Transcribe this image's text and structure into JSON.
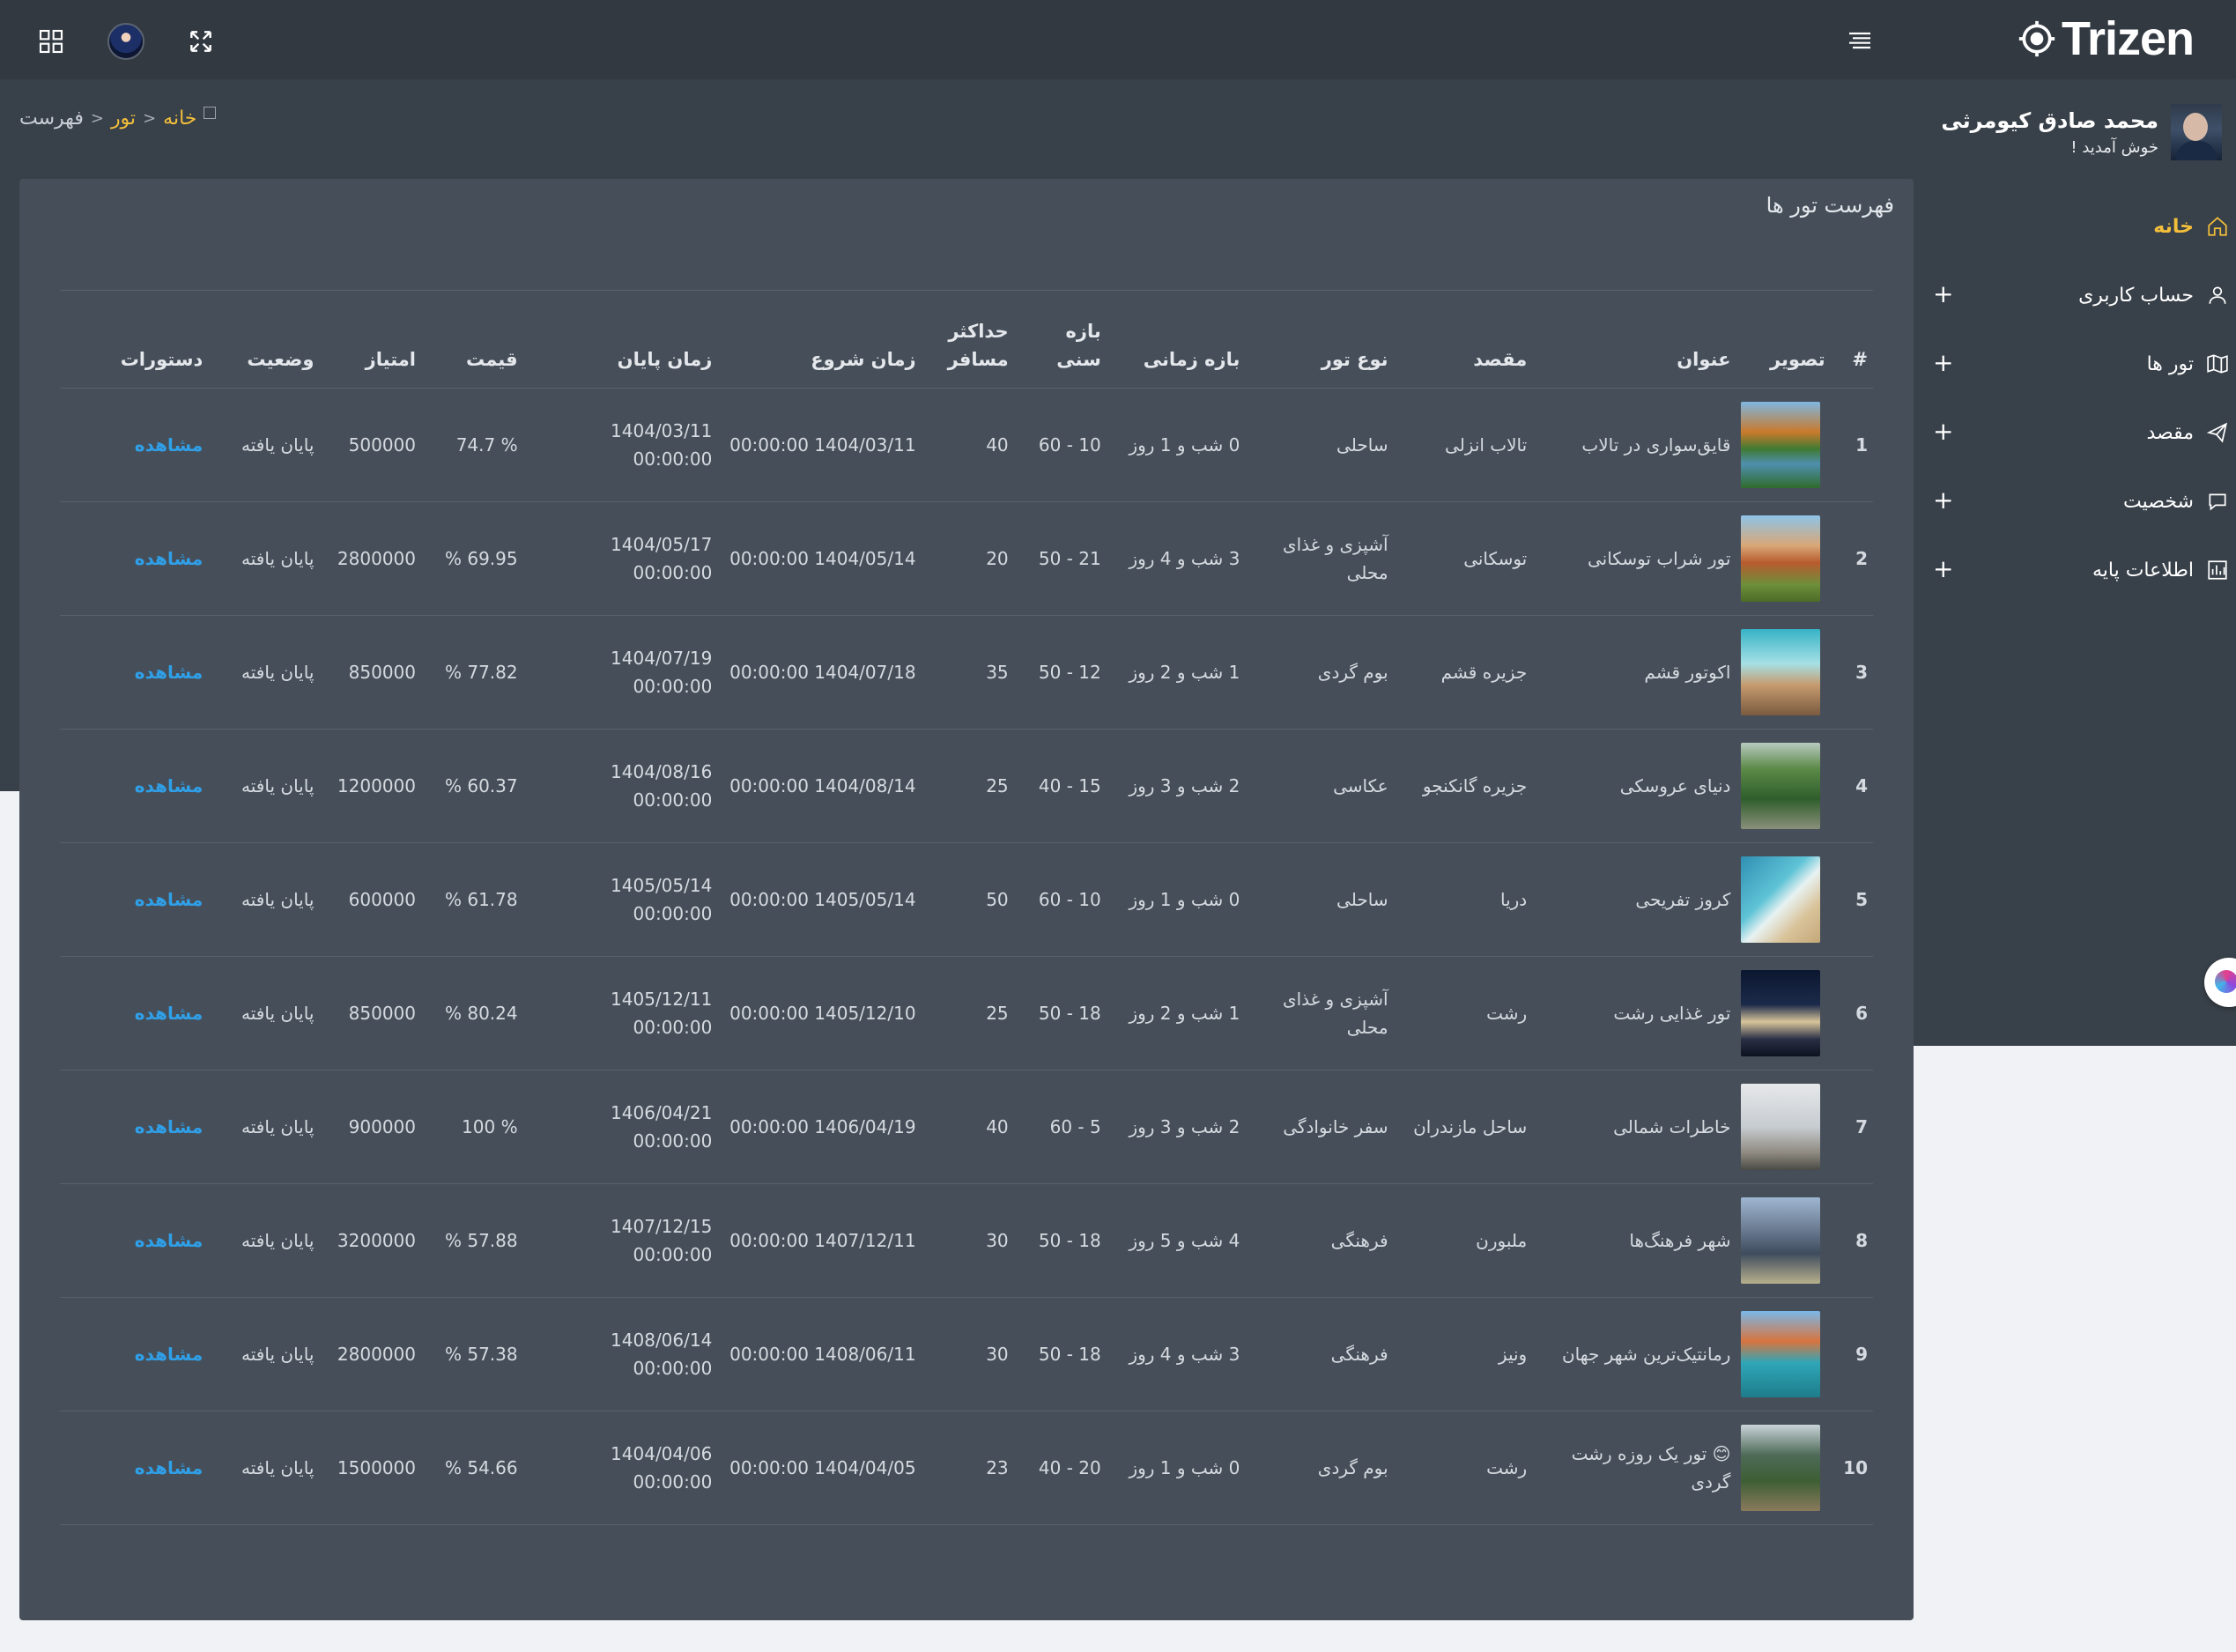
{
  "app": {
    "logo_text": "Trizen"
  },
  "user": {
    "name": "محمد صادق کیومرثی",
    "welcome": "خوش آمدید !"
  },
  "breadcrumb": {
    "home": "خانه",
    "sep1": ">",
    "section": "تور",
    "sep2": ">",
    "current": "فهرست"
  },
  "sidebar": {
    "items": [
      {
        "label": "خانه",
        "icon": "home-icon",
        "active": true,
        "expand": ""
      },
      {
        "label": "حساب کاربری",
        "icon": "user-icon",
        "active": false,
        "expand": "+"
      },
      {
        "label": "تور ها",
        "icon": "map-icon",
        "active": false,
        "expand": "+"
      },
      {
        "label": "مقصد",
        "icon": "send-icon",
        "active": false,
        "expand": "+"
      },
      {
        "label": "شخصیت",
        "icon": "chat-icon",
        "active": false,
        "expand": "+"
      },
      {
        "label": "اطلاعات پایه",
        "icon": "chart-icon",
        "active": false,
        "expand": "+"
      }
    ]
  },
  "card": {
    "title": "فهرست تور ها"
  },
  "table": {
    "columns": [
      "#",
      "تصویر",
      "عنوان",
      "مقصد",
      "نوع تور",
      "بازه زمانی",
      "بازه سنی",
      "حداکثر مسافر",
      "زمان شروع",
      "زمان پایان",
      "قیمت",
      "امتیاز",
      "وضعیت",
      "دستورات"
    ],
    "rows": [
      {
        "num": "1",
        "title": "قایق‌سواری در تالاب",
        "dest": "تالاب انزلی",
        "type": "ساحلی",
        "duration": "0 شب و 1 روز",
        "age": "10 - 60",
        "max": "40",
        "start": "1404/03/11 00:00:00",
        "end": "1404/03/11 00:00:00",
        "price": "% 74.7",
        "score": "500000",
        "status": "پایان یافته",
        "action": "مشاهده",
        "image": "lake"
      },
      {
        "num": "2",
        "title": "تور شراب توسکانی",
        "dest": "توسکانی",
        "type": "آشپزی و غذای محلی",
        "duration": "3 شب و 4 روز",
        "age": "21 - 50",
        "max": "20",
        "start": "1404/05/14 00:00:00",
        "end": "1404/05/17 00:00:00",
        "price": "69.95 %",
        "score": "2800000",
        "status": "پایان یافته",
        "action": "مشاهده",
        "image": "tuscany"
      },
      {
        "num": "3",
        "title": "اکوتور قشم",
        "dest": "جزیره قشم",
        "type": "بوم گردی",
        "duration": "1 شب و 2 روز",
        "age": "12 - 50",
        "max": "35",
        "start": "1404/07/18 00:00:00",
        "end": "1404/07/19 00:00:00",
        "price": "77.82 %",
        "score": "850000",
        "status": "پایان یافته",
        "action": "مشاهده",
        "image": "coast"
      },
      {
        "num": "4",
        "title": "دنیای عروسکی",
        "dest": "جزیره گانکنجو",
        "type": "عکاسی",
        "duration": "2 شب و 3 روز",
        "age": "15 - 40",
        "max": "25",
        "start": "1404/08/14 00:00:00",
        "end": "1404/08/16 00:00:00",
        "price": "60.37 %",
        "score": "1200000",
        "status": "پایان یافته",
        "action": "مشاهده",
        "image": "cliffs"
      },
      {
        "num": "5",
        "title": "کروز تفریحی",
        "dest": "دریا",
        "type": "ساحلی",
        "duration": "0 شب و 1 روز",
        "age": "10 - 60",
        "max": "50",
        "start": "1405/05/14 00:00:00",
        "end": "1405/05/14 00:00:00",
        "price": "61.78 %",
        "score": "600000",
        "status": "پایان یافته",
        "action": "مشاهده",
        "image": "beach"
      },
      {
        "num": "6",
        "title": "تور غذایی رشت",
        "dest": "رشت",
        "type": "آشپزی و غذای محلی",
        "duration": "1 شب و 2 روز",
        "age": "18 - 50",
        "max": "25",
        "start": "1405/12/10 00:00:00",
        "end": "1405/12/11 00:00:00",
        "price": "80.24 %",
        "score": "850000",
        "status": "پایان یافته",
        "action": "مشاهده",
        "image": "night"
      },
      {
        "num": "7",
        "title": "خاطرات شمالی",
        "dest": "ساحل مازندران",
        "type": "سفر خانوادگی",
        "duration": "2 شب و 3 روز",
        "age": "5 - 60",
        "max": "40",
        "start": "1406/04/19 00:00:00",
        "end": "1406/04/21 00:00:00",
        "price": "% 100",
        "score": "900000",
        "status": "پایان یافته",
        "action": "مشاهده",
        "image": "birds"
      },
      {
        "num": "8",
        "title": "شهر فرهنگ‌ها",
        "dest": "ملبورن",
        "type": "فرهنگی",
        "duration": "4 شب و 5 روز",
        "age": "18 - 50",
        "max": "30",
        "start": "1407/12/11 00:00:00",
        "end": "1407/12/15 00:00:00",
        "price": "57.88 %",
        "score": "3200000",
        "status": "پایان یافته",
        "action": "مشاهده",
        "image": "city"
      },
      {
        "num": "9",
        "title": "رمانتیک‌ترین شهر جهان",
        "dest": "ونیز",
        "type": "فرهنگی",
        "duration": "3 شب و 4 روز",
        "age": "18 - 50",
        "max": "30",
        "start": "1408/06/11 00:00:00",
        "end": "1408/06/14 00:00:00",
        "price": "57.38 %",
        "score": "2800000",
        "status": "پایان یافته",
        "action": "مشاهده",
        "image": "venice"
      },
      {
        "num": "10",
        "title": "😊 تور یک روزه رشت گردی",
        "dest": "رشت",
        "type": "بوم گردی",
        "duration": "0 شب و 1 روز",
        "age": "20 - 40",
        "max": "23",
        "start": "1404/04/05 00:00:00",
        "end": "1404/04/06 00:00:00",
        "price": "54.66 %",
        "score": "1500000",
        "status": "پایان یافته",
        "action": "مشاهده",
        "image": "village"
      }
    ]
  },
  "colors": {
    "accent": "#f3bf3b",
    "link": "#2f9fe8",
    "card": "#464f59",
    "sidebar": "#384049",
    "topbar": "#323941"
  }
}
